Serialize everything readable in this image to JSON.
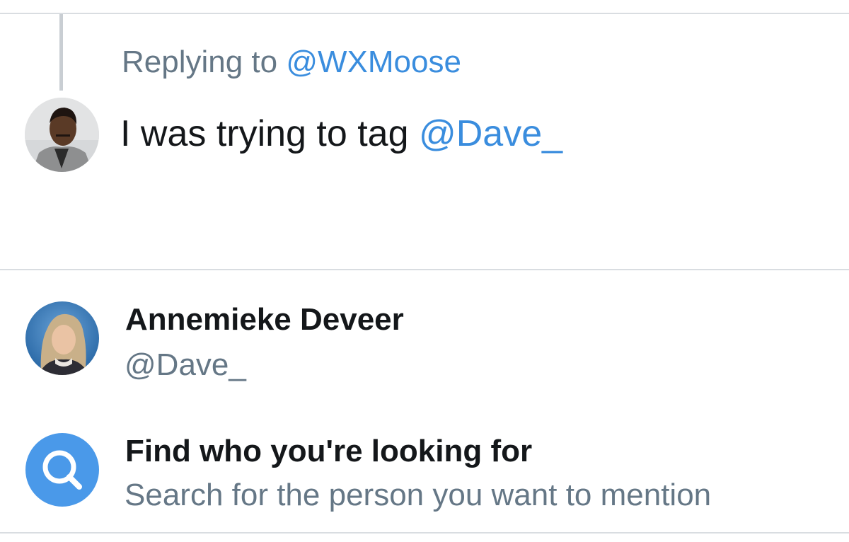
{
  "reply_header": {
    "prefix": "Replying to ",
    "handle": "@WXMoose"
  },
  "compose": {
    "text": "I was trying to tag ",
    "mention": "@Dave_"
  },
  "suggestions": [
    {
      "name": "Annemieke Deveer",
      "handle": "@Dave_",
      "avatar_icon": "user-avatar-photo"
    }
  ],
  "search_prompt": {
    "title": "Find who you're looking for",
    "subtitle": "Search for the person you want to mention",
    "icon": "search-icon"
  },
  "colors": {
    "link": "#3a8dde",
    "search_badge": "#4a99e9",
    "secondary_text": "#657786",
    "primary_text": "#14171a"
  }
}
